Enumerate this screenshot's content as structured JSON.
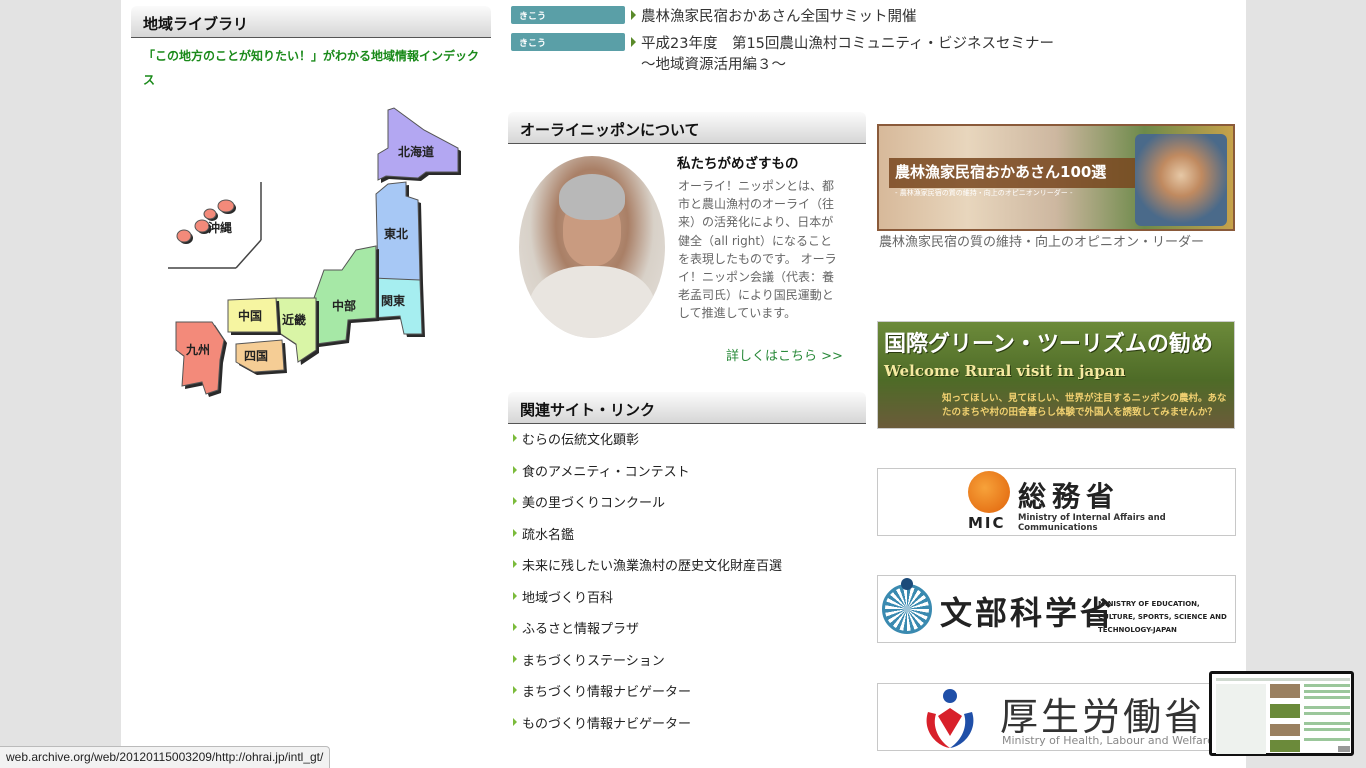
{
  "library": {
    "title": "地域ライブラリ",
    "description": "「この地方のことが知りたい！」がわかる地域情報インデックス",
    "regions": [
      {
        "name": "北海道",
        "color": "#b3a7f2"
      },
      {
        "name": "東北",
        "color": "#a7c8f5"
      },
      {
        "name": "関東",
        "color": "#a6eef0"
      },
      {
        "name": "中部",
        "color": "#a6e8a6"
      },
      {
        "name": "近畿",
        "color": "#d9f5a6"
      },
      {
        "name": "中国",
        "color": "#f6f5a1"
      },
      {
        "name": "四国",
        "color": "#f5cd95"
      },
      {
        "name": "九州",
        "color": "#f38a7a"
      },
      {
        "name": "沖縄",
        "color": "#f38a7a"
      }
    ]
  },
  "news": [
    {
      "badge": "きこう",
      "text": "農林漁家民宿おかあさん全国サミット開催"
    },
    {
      "badge": "きこう",
      "text": "平成23年度　第15回農山漁村コミュニティ・ビジネスセミナー",
      "text2": "〜地域資源活用編３〜"
    }
  ],
  "about": {
    "title": "オーライニッポンについて",
    "subtitle": "私たちがめざすもの",
    "body": "オーライ！ニッポンとは、都市と農山漁村のオーライ（往来）の活発化により、日本が健全（all right）になることを表現したものです。 オーライ！ニッポン会議（代表：養老孟司氏）により国民運動として推進しています。",
    "more": "詳しくはこちら >>"
  },
  "links": {
    "title": "関連サイト・リンク",
    "items": [
      "むらの伝統文化顕彰",
      "食のアメニティ・コンテスト",
      "美の里づくりコンクール",
      "疏水名鑑",
      "未来に残したい漁業漁村の歴史文化財産百選",
      "地域づくり百科",
      "ふるさと情報プラザ",
      "まちづくりステーション",
      "まちづくり情報ナビゲーター",
      "ものづくり情報ナビゲーター"
    ]
  },
  "banners": {
    "okaasan": {
      "title": "農林漁家民宿おかあさん100選",
      "subtitle": "- 農林漁家民宿の質の維持・向上のオピニオンリーダー -",
      "caption": "農林漁家民宿の質の維持・向上のオピニオン・リーダー"
    },
    "green_tourism": {
      "title": "国際グリーン・ツーリズムの勧め",
      "subtitle": "Welcome Rural visit in japan",
      "tagline": "知ってほしい、見てほしい、世界が注目するニッポンの農村。あなたのまちや村の田舎暮らし体験で外国人を誘致してみませんか？"
    },
    "mic": {
      "jp": "総務省",
      "abbr": "MIC",
      "en": "Ministry of Internal Affairs and Communications"
    },
    "mext": {
      "jp": "文部科学省",
      "en": "MINISTRY OF EDUCATION, CULTURE, SPORTS, SCIENCE AND TECHNOLOGY-JAPAN"
    },
    "mhlw": {
      "jp": "厚生労働省",
      "en": "Ministry of Health, Labour and Welfare"
    }
  },
  "status_bar": {
    "url": "web.archive.org/web/20120115003209/http://ohrai.jp/intl_gt/"
  }
}
